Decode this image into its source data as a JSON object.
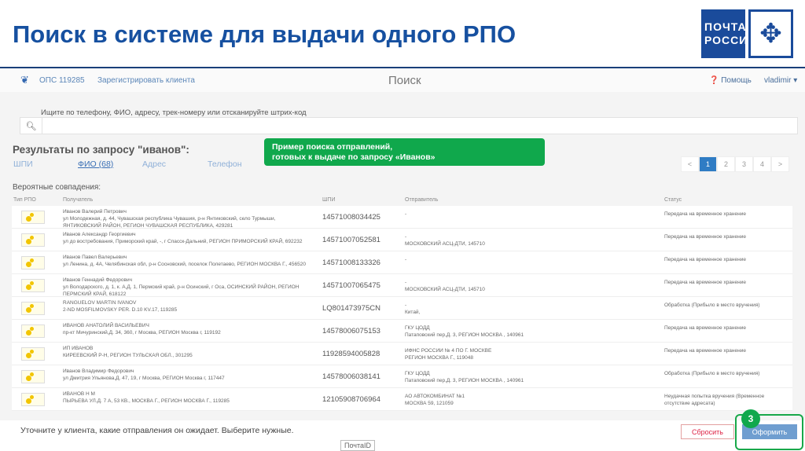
{
  "slide": {
    "title": "Поиск в системе для выдачи одного РПО",
    "logo": "ПОЧТА РОССИИ"
  },
  "nav": {
    "ops": "ОПС 119285",
    "register": "Зарегистрировать клиента",
    "page_title": "Поиск",
    "help": "Помощь",
    "user": "vladimir"
  },
  "search": {
    "hint": "Ищите по телефону, ФИО, адресу, трек-номеру или отсканируйте штрих-код",
    "value": ""
  },
  "results": {
    "heading": "Результаты по запросу \"иванов\":",
    "tabs": [
      "ШПИ",
      "ФИО (68)",
      "Адрес",
      "Телефон"
    ],
    "probable": "Вероятные совпадения:"
  },
  "callout": {
    "line1": "Пример поиска отправлений,",
    "line2": "готовых к выдаче по запросу «Иванов»"
  },
  "pager": [
    "<",
    "1",
    "2",
    "3",
    "4",
    ">"
  ],
  "table": {
    "headers": [
      "Тип РПО",
      "Получатель",
      "ШПИ",
      "Отправитель",
      "Статус"
    ],
    "rows": [
      {
        "name": "Иванов Валерий Петрович",
        "addr": "ул Молодежная, д. 44, Чувашская республика Чувашия, р-н Янтиковский, село Турмыши, ЯНТИКОВСКИЙ РАЙОН, РЕГИОН ЧУВАШСКАЯ РЕСПУБЛИКА, 429281",
        "track": "14571008034425",
        "sender": "-",
        "sender2": "",
        "status": "Передача на временное хранение"
      },
      {
        "name": "Иванов Александр Георгиевич",
        "addr": "ул до востребования, Приморский край, -, г Спасск-Дальний, РЕГИОН ПРИМОРСКИЙ КРАЙ, 692232",
        "track": "14571007052581",
        "sender": "-",
        "sender2": "МОСКОВСКИЙ АСЦ-ДТИ, 145710",
        "status": "Передача на временное хранение"
      },
      {
        "name": "Иванов Павел Валерьевич",
        "addr": "ул Ленина, д. 4А, Челябинская обл, р-н Сосновский, поселок Полетаево, РЕГИОН МОСКВА Г., 456520",
        "track": "14571008133326",
        "sender": "-",
        "sender2": "",
        "status": "Передача на временное хранение"
      },
      {
        "name": "Иванов Геннадий Федорович",
        "addr": "ул Володарского, д. 1, к. А,Д. 1, Пермский край, р-н Осинский, г Оса, ОСИНСКИЙ РАЙОН, РЕГИОН ПЕРМСКИЙ КРАЙ, 618122",
        "track": "14571007065475",
        "sender": "-",
        "sender2": "МОСКОВСКИЙ АСЦ-ДТИ, 145710",
        "status": "Передача на временное хранение"
      },
      {
        "name": "RANGUELOV MARTIN IVANOV",
        "addr": "2-ND MOSFILMOVSKY PER. D.10 KV.17, 119285",
        "track": "LQ801473975CN",
        "sender": "-",
        "sender2": "Китай,",
        "status": "Обработка (Прибыло в место вручения)"
      },
      {
        "name": "ИВАНОВ АНАТОЛИЙ ВАСИЛЬЕВИЧ",
        "addr": "пр-кт Мичуринский,Д. 34, 360, г Москва, РЕГИОН Москва г, 119192",
        "track": "14578006075153",
        "sender": "ГКУ ЦОДД",
        "sender2": "Патаповский пер,Д. 3, РЕГИОН МОСКВА , 140961",
        "status": "Передача на временное хранение"
      },
      {
        "name": "ИП ИВАНОВ",
        "addr": "КИРЕЕВСКИЙ Р-Н, РЕГИОН ТУЛЬСКАЯ ОБЛ., 301295",
        "track": "11928594005828",
        "sender": "ИФНС РОССИИ № 4 ПО Г. МОСКВЕ",
        "sender2": "РЕГИОН МОСКВА Г., 119048",
        "status": "Передача на временное хранение"
      },
      {
        "name": "Иванов Владимир Федорович",
        "addr": "ул Дмитрия Ульянова,Д. 47, 19, г Москва, РЕГИОН Москва г, 117447",
        "track": "14578006038141",
        "sender": "ГКУ ЦОДД",
        "sender2": "Патаповский пер,Д. 3, РЕГИОН МОСКВА , 140961",
        "status": "Обработка (Прибыло в место вручения)"
      },
      {
        "name": "ИВАНОВ Н М",
        "addr": "ПЫРЬЕВА УЛ.Д. 7 А, 53 КВ., МОСКВА Г., РЕГИОН МОСКВА Г., 119285",
        "track": "12105908706964",
        "sender": "АО АВТОКОМБИНАТ №1",
        "sender2": "МОСКВА 59, 121059",
        "status": "Неудачная попытка вручения (Временное отсутствие адресата)"
      }
    ]
  },
  "bottom": {
    "message": "Уточните у клиента, какие отправления он ожидает. Выберите нужные.",
    "pochta_id": "ПочтаID",
    "reset": "Сбросить",
    "submit": "Оформить",
    "step": "3"
  }
}
